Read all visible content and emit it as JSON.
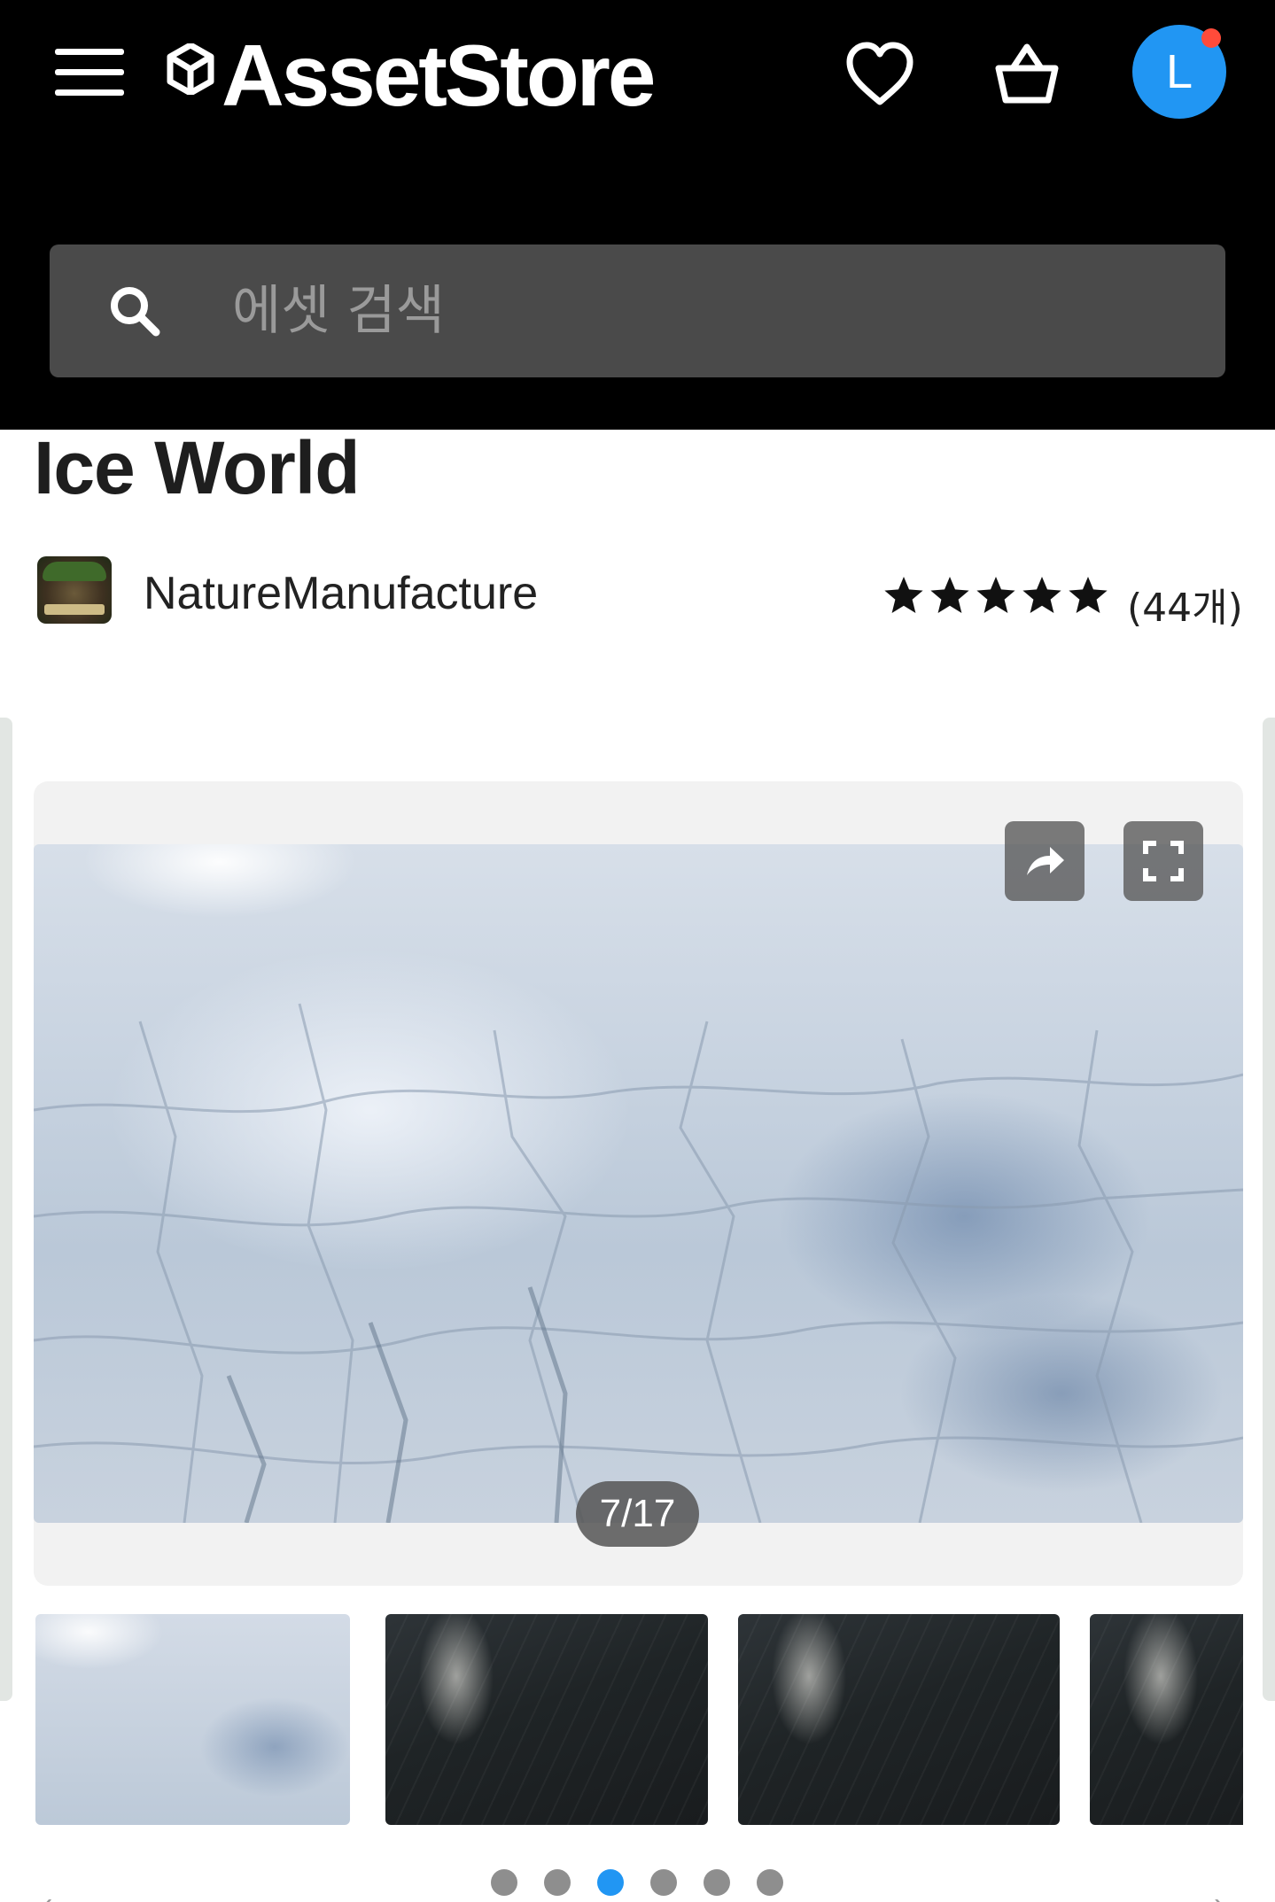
{
  "header": {
    "brand": "AssetStore",
    "avatar_letter": "L",
    "colors": {
      "background": "#000000",
      "avatar": "#2196f3",
      "notification": "#ff4b3a"
    },
    "icons": [
      "menu-icon",
      "unity-logo-icon",
      "heart-icon",
      "basket-icon"
    ]
  },
  "search": {
    "placeholder": "에셋 검색",
    "icon": "search-icon"
  },
  "product": {
    "title": "Ice World",
    "publisher": "NatureManufacture",
    "rating_stars": 5,
    "rating_count": "(44개)"
  },
  "gallery": {
    "counter": "7/17",
    "current_index": 7,
    "total": 17,
    "buttons": [
      "share-icon",
      "fullscreen-icon"
    ],
    "dots_count": 6,
    "active_dot": 3,
    "accent": "#2196f3"
  }
}
